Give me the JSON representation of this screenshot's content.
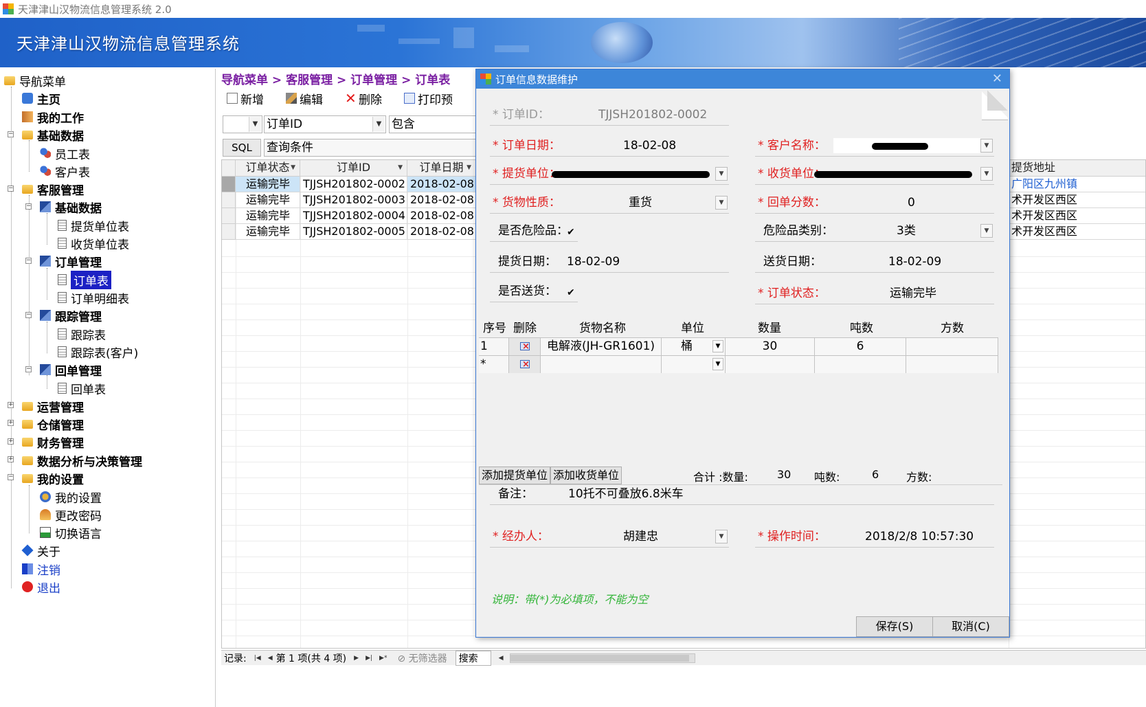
{
  "window": {
    "title": "天津津山汉物流信息管理系统 2.0"
  },
  "banner": {
    "title": "天津津山汉物流信息管理系统"
  },
  "sidebar": {
    "root": "导航菜单",
    "items": [
      {
        "label": "主页"
      },
      {
        "label": "我的工作"
      },
      {
        "label": "基础数据"
      },
      {
        "label": "员工表"
      },
      {
        "label": "客户表"
      },
      {
        "label": "客服管理"
      },
      {
        "label": "基础数据"
      },
      {
        "label": "提货单位表"
      },
      {
        "label": "收货单位表"
      },
      {
        "label": "订单管理"
      },
      {
        "label": "订单表"
      },
      {
        "label": "订单明细表"
      },
      {
        "label": "跟踪管理"
      },
      {
        "label": "跟踪表"
      },
      {
        "label": "跟踪表(客户)"
      },
      {
        "label": "回单管理"
      },
      {
        "label": "回单表"
      },
      {
        "label": "运营管理"
      },
      {
        "label": "仓储管理"
      },
      {
        "label": "财务管理"
      },
      {
        "label": "数据分析与决策管理"
      },
      {
        "label": "我的设置"
      },
      {
        "label": "我的设置"
      },
      {
        "label": "更改密码"
      },
      {
        "label": "切换语言"
      },
      {
        "label": "关于"
      },
      {
        "label": "注销"
      },
      {
        "label": "退出"
      }
    ]
  },
  "main": {
    "breadcrumb": "导航菜单 > 客服管理 > 订单管理 > 订单表",
    "toolbar": {
      "new": "新增",
      "edit": "编辑",
      "delete": "删除",
      "print": "打印预"
    },
    "filter": {
      "field": "订单ID",
      "operator": "包含",
      "sql": "SQL",
      "query_placeholder": "查询条件"
    },
    "grid": {
      "columns": [
        "订单状态",
        "订单ID",
        "订单日期"
      ],
      "extra_column": "提货地址",
      "rows": [
        {
          "status": "运输完毕",
          "id": "TJJSH201802-0002",
          "date": "2018-02-08",
          "addr": "广阳区九州镇"
        },
        {
          "status": "运输完毕",
          "id": "TJJSH201802-0003",
          "date": "2018-02-08",
          "addr": "术开发区西区"
        },
        {
          "status": "运输完毕",
          "id": "TJJSH201802-0004",
          "date": "2018-02-08",
          "addr": "术开发区西区"
        },
        {
          "status": "运输完毕",
          "id": "TJJSH201802-0005",
          "date": "2018-02-08",
          "addr": "术开发区西区"
        }
      ]
    },
    "status": {
      "record": "记录:",
      "position": "第 1 项(共 4 项)",
      "no_filter": "无筛选器",
      "search": "搜索"
    }
  },
  "dialog": {
    "title": "订单信息数据维护",
    "order_id_label": "* 订单ID：",
    "order_id": "TJJSH201802-0002",
    "order_date_label": "* 订单日期：",
    "order_date": "18-02-08",
    "customer_label": "* 客户名称：",
    "pickup_unit_label": "* 提货单位：",
    "receive_unit_label": "* 收货单位：",
    "cargo_type_label": "* 货物性质：",
    "cargo_type": "重货",
    "receipt_count_label": "* 回单分数：",
    "receipt_count": "0",
    "dangerous_label": "是否危险品：",
    "check_mark": "✔",
    "danger_class_label": "危险品类别：",
    "danger_class": "3类",
    "pickup_date_label": "提货日期：",
    "pickup_date": "18-02-09",
    "delivery_date_label": "送货日期：",
    "delivery_date": "18-02-09",
    "deliver_label": "是否送货：",
    "order_status_label": "* 订单状态：",
    "order_status": "运输完毕",
    "detail": {
      "headers": [
        "序号",
        "删除",
        "货物名称",
        "单位",
        "数量",
        "吨数",
        "方数"
      ],
      "rows": [
        {
          "no": "1",
          "name": "电解液(JH-GR1601)",
          "unit": "桶",
          "qty": "30",
          "tons": "6",
          "vol": ""
        },
        {
          "no": "*",
          "name": "",
          "unit": "",
          "qty": "",
          "tons": "",
          "vol": ""
        }
      ]
    },
    "add_pickup": "添加提货单位",
    "add_receive": "添加收货单位",
    "sum_label": "合计 :数量:",
    "sum_qty": "30",
    "sum_tons_label": "吨数:",
    "sum_tons": "6",
    "sum_vol_label": "方数:",
    "remark_label": "备注：",
    "remark": "10托不可叠放6.8米车",
    "handler_label": "* 经办人：",
    "handler": "胡建忠",
    "op_time_label": "* 操作时间：",
    "op_time": "2018/2/8 10:57:30",
    "note": "说明：带(*)为必填项，不能为空",
    "save": "保存(S)",
    "cancel": "取消(C)"
  },
  "colors": {
    "banner": "#2b74d6",
    "dialog_title": "#3d86d9",
    "breadcrumb": "#7a1fa2",
    "required": "#e02020",
    "note": "#34b53a",
    "selection": "#1c21c4"
  }
}
